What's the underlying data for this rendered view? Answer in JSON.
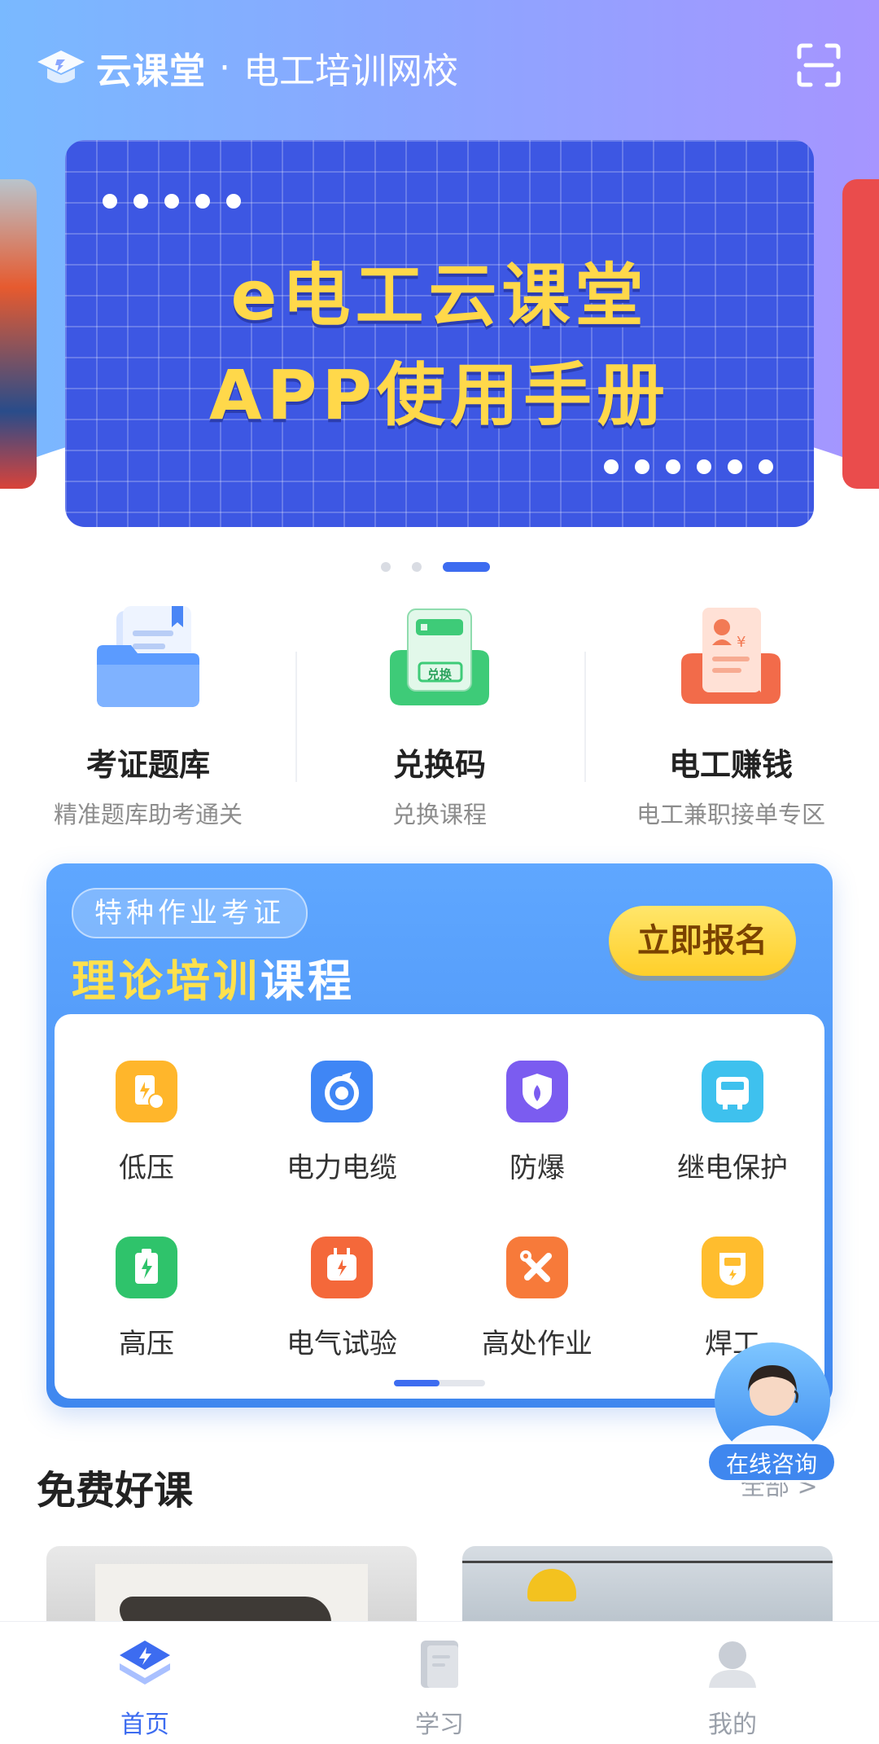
{
  "header": {
    "brand": "云课堂",
    "separator": "·",
    "subtitle": "电工培训网校"
  },
  "banner": {
    "title_line1": "e电工云课堂",
    "title_line2": "APP使用手册",
    "page_count": 3,
    "active_page": 3
  },
  "quick_entries": [
    {
      "title": "考证题库",
      "subtitle": "精准题库助考通关"
    },
    {
      "title": "兑换码",
      "subtitle": "兑换课程",
      "icon_text": "兑换"
    },
    {
      "title": "电工赚钱",
      "subtitle": "电工兼职接单专区"
    }
  ],
  "theory": {
    "tag": "特种作业考证",
    "title_highlight": "理论培训",
    "title_rest": "课程",
    "enroll_label": "立即报名",
    "categories": [
      {
        "label": "低压",
        "color": "#ffb62b"
      },
      {
        "label": "电力电缆",
        "color": "#3f86f5"
      },
      {
        "label": "防爆",
        "color": "#7b5cf0"
      },
      {
        "label": "继电保护",
        "color": "#3ec1ee"
      },
      {
        "label": "高压",
        "color": "#2fc36b"
      },
      {
        "label": "电气试验",
        "color": "#f4683a"
      },
      {
        "label": "高处作业",
        "color": "#f77a3a"
      },
      {
        "label": "焊工",
        "color": "#ffbd2e"
      }
    ]
  },
  "consult": {
    "label": "在线咨询"
  },
  "free_section": {
    "title": "免费好课",
    "more": "全部 >"
  },
  "tabs": [
    {
      "label": "首页",
      "active": true,
      "color": "#3d6cf0"
    },
    {
      "label": "学习",
      "active": false,
      "color": "#9aa0aa"
    },
    {
      "label": "我的",
      "active": false,
      "color": "#9aa0aa"
    }
  ]
}
